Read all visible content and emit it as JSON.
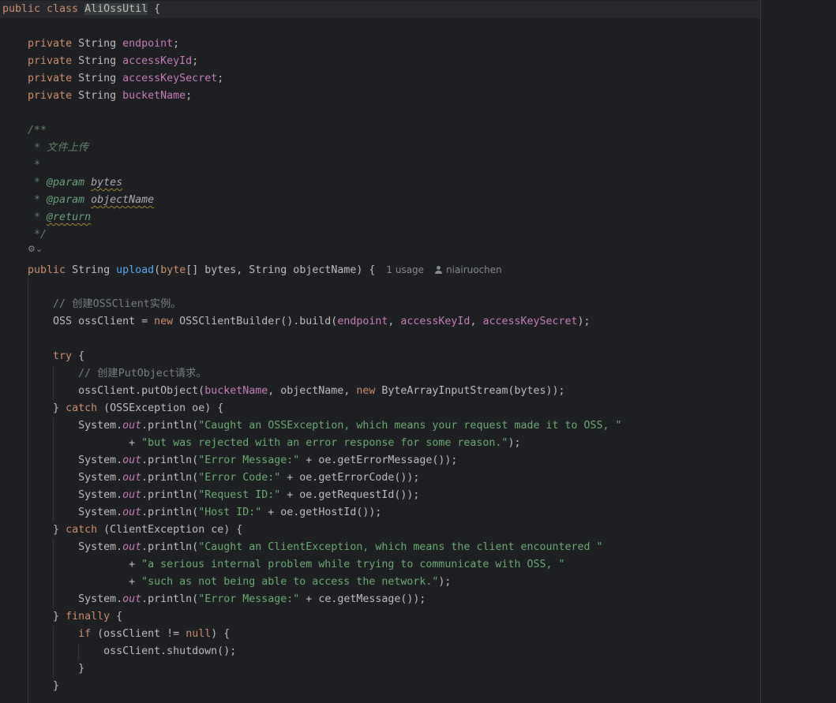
{
  "editor": {
    "gutter_icon_label": "⚙⌄",
    "lines": [
      [
        [
          "kw",
          "public class "
        ],
        [
          "class",
          "AliOssUtil"
        ],
        [
          "text",
          " {"
        ]
      ],
      [],
      [
        [
          "text",
          "    "
        ],
        [
          "kw",
          "private "
        ],
        [
          "text",
          "String "
        ],
        [
          "field",
          "endpoint"
        ],
        [
          "text",
          ";"
        ]
      ],
      [
        [
          "text",
          "    "
        ],
        [
          "kw",
          "private "
        ],
        [
          "text",
          "String "
        ],
        [
          "field",
          "accessKeyId"
        ],
        [
          "text",
          ";"
        ]
      ],
      [
        [
          "text",
          "    "
        ],
        [
          "kw",
          "private "
        ],
        [
          "text",
          "String "
        ],
        [
          "field",
          "accessKeySecret"
        ],
        [
          "text",
          ";"
        ]
      ],
      [
        [
          "text",
          "    "
        ],
        [
          "kw",
          "private "
        ],
        [
          "text",
          "String "
        ],
        [
          "field",
          "bucketName"
        ],
        [
          "text",
          ";"
        ]
      ],
      [],
      [
        [
          "text",
          "    "
        ],
        [
          "doc",
          "/**"
        ]
      ],
      [
        [
          "text",
          "     "
        ],
        [
          "doc",
          "* 文件上传"
        ]
      ],
      [
        [
          "text",
          "     "
        ],
        [
          "doc",
          "*"
        ]
      ],
      [
        [
          "text",
          "     "
        ],
        [
          "doc",
          "* "
        ],
        [
          "doctag",
          "@param "
        ],
        [
          "docparam_typo",
          "bytes"
        ]
      ],
      [
        [
          "text",
          "     "
        ],
        [
          "doc",
          "* "
        ],
        [
          "doctag",
          "@param "
        ],
        [
          "docparam_typo",
          "objectName"
        ]
      ],
      [
        [
          "text",
          "     "
        ],
        [
          "doc",
          "* "
        ],
        [
          "doctag_typo",
          "@return"
        ]
      ],
      [
        [
          "text",
          "     "
        ],
        [
          "doc",
          "*/"
        ]
      ],
      [],
      [
        [
          "text",
          "    "
        ],
        [
          "kw",
          "public "
        ],
        [
          "text",
          "String "
        ],
        [
          "method",
          "upload"
        ],
        [
          "text",
          "("
        ],
        [
          "kw",
          "byte"
        ],
        [
          "text",
          "[] bytes, String objectName) {"
        ],
        [
          "inlay",
          "1 usage"
        ],
        [
          "author",
          "niairuochen"
        ]
      ],
      [],
      [
        [
          "text",
          "        "
        ],
        [
          "comment",
          "// 创建OSSClient实例。"
        ]
      ],
      [
        [
          "text",
          "        OSS ossClient = "
        ],
        [
          "kw",
          "new "
        ],
        [
          "text",
          "OSSClientBuilder().build("
        ],
        [
          "field",
          "endpoint"
        ],
        [
          "text",
          ", "
        ],
        [
          "field",
          "accessKeyId"
        ],
        [
          "text",
          ", "
        ],
        [
          "field",
          "accessKeySecret"
        ],
        [
          "text",
          ");"
        ]
      ],
      [],
      [
        [
          "text",
          "        "
        ],
        [
          "kw",
          "try "
        ],
        [
          "text",
          "{"
        ]
      ],
      [
        [
          "text",
          "            "
        ],
        [
          "comment",
          "// 创建PutObject请求。"
        ]
      ],
      [
        [
          "text",
          "            ossClient.putObject("
        ],
        [
          "field",
          "bucketName"
        ],
        [
          "text",
          ", objectName, "
        ],
        [
          "kw",
          "new "
        ],
        [
          "text",
          "ByteArrayInputStream(bytes));"
        ]
      ],
      [
        [
          "text",
          "        } "
        ],
        [
          "kw",
          "catch "
        ],
        [
          "text",
          "(OSSException oe) {"
        ]
      ],
      [
        [
          "text",
          "            System."
        ],
        [
          "static",
          "out"
        ],
        [
          "text",
          ".println("
        ],
        [
          "str",
          "\"Caught an OSSException, which means your request made it to OSS, \""
        ]
      ],
      [
        [
          "text",
          "                    + "
        ],
        [
          "str",
          "\"but was rejected with an error response for some reason.\""
        ],
        [
          "text",
          ");"
        ]
      ],
      [
        [
          "text",
          "            System."
        ],
        [
          "static",
          "out"
        ],
        [
          "text",
          ".println("
        ],
        [
          "str",
          "\"Error Message:\""
        ],
        [
          "text",
          " + oe.getErrorMessage());"
        ]
      ],
      [
        [
          "text",
          "            System."
        ],
        [
          "static",
          "out"
        ],
        [
          "text",
          ".println("
        ],
        [
          "str",
          "\"Error Code:\""
        ],
        [
          "text",
          " + oe.getErrorCode());"
        ]
      ],
      [
        [
          "text",
          "            System."
        ],
        [
          "static",
          "out"
        ],
        [
          "text",
          ".println("
        ],
        [
          "str",
          "\"Request ID:\""
        ],
        [
          "text",
          " + oe.getRequestId());"
        ]
      ],
      [
        [
          "text",
          "            System."
        ],
        [
          "static",
          "out"
        ],
        [
          "text",
          ".println("
        ],
        [
          "str",
          "\"Host ID:\""
        ],
        [
          "text",
          " + oe.getHostId());"
        ]
      ],
      [
        [
          "text",
          "        } "
        ],
        [
          "kw",
          "catch "
        ],
        [
          "text",
          "(ClientException ce) {"
        ]
      ],
      [
        [
          "text",
          "            System."
        ],
        [
          "static",
          "out"
        ],
        [
          "text",
          ".println("
        ],
        [
          "str",
          "\"Caught an ClientException, which means the client encountered \""
        ]
      ],
      [
        [
          "text",
          "                    + "
        ],
        [
          "str",
          "\"a serious internal problem while trying to communicate with OSS, \""
        ]
      ],
      [
        [
          "text",
          "                    + "
        ],
        [
          "str",
          "\"such as not being able to access the network.\""
        ],
        [
          "text",
          ");"
        ]
      ],
      [
        [
          "text",
          "            System."
        ],
        [
          "static",
          "out"
        ],
        [
          "text",
          ".println("
        ],
        [
          "str",
          "\"Error Message:\""
        ],
        [
          "text",
          " + ce.getMessage());"
        ]
      ],
      [
        [
          "text",
          "        } "
        ],
        [
          "kw",
          "finally "
        ],
        [
          "text",
          "{"
        ]
      ],
      [
        [
          "text",
          "            "
        ],
        [
          "kw",
          "if "
        ],
        [
          "text",
          "(ossClient != "
        ],
        [
          "kw",
          "null"
        ],
        [
          "text",
          ") {"
        ]
      ],
      [
        [
          "text",
          "                ossClient.shutdown();"
        ]
      ],
      [
        [
          "text",
          "            }"
        ]
      ],
      [
        [
          "text",
          "        }"
        ]
      ]
    ]
  },
  "colors": {
    "background": "#1e1f22",
    "keyword": "#cf8e6d",
    "field": "#c77dbb",
    "string": "#6aab73",
    "comment": "#7a7e85",
    "method": "#56a8f5",
    "doc": "#5f826b"
  }
}
